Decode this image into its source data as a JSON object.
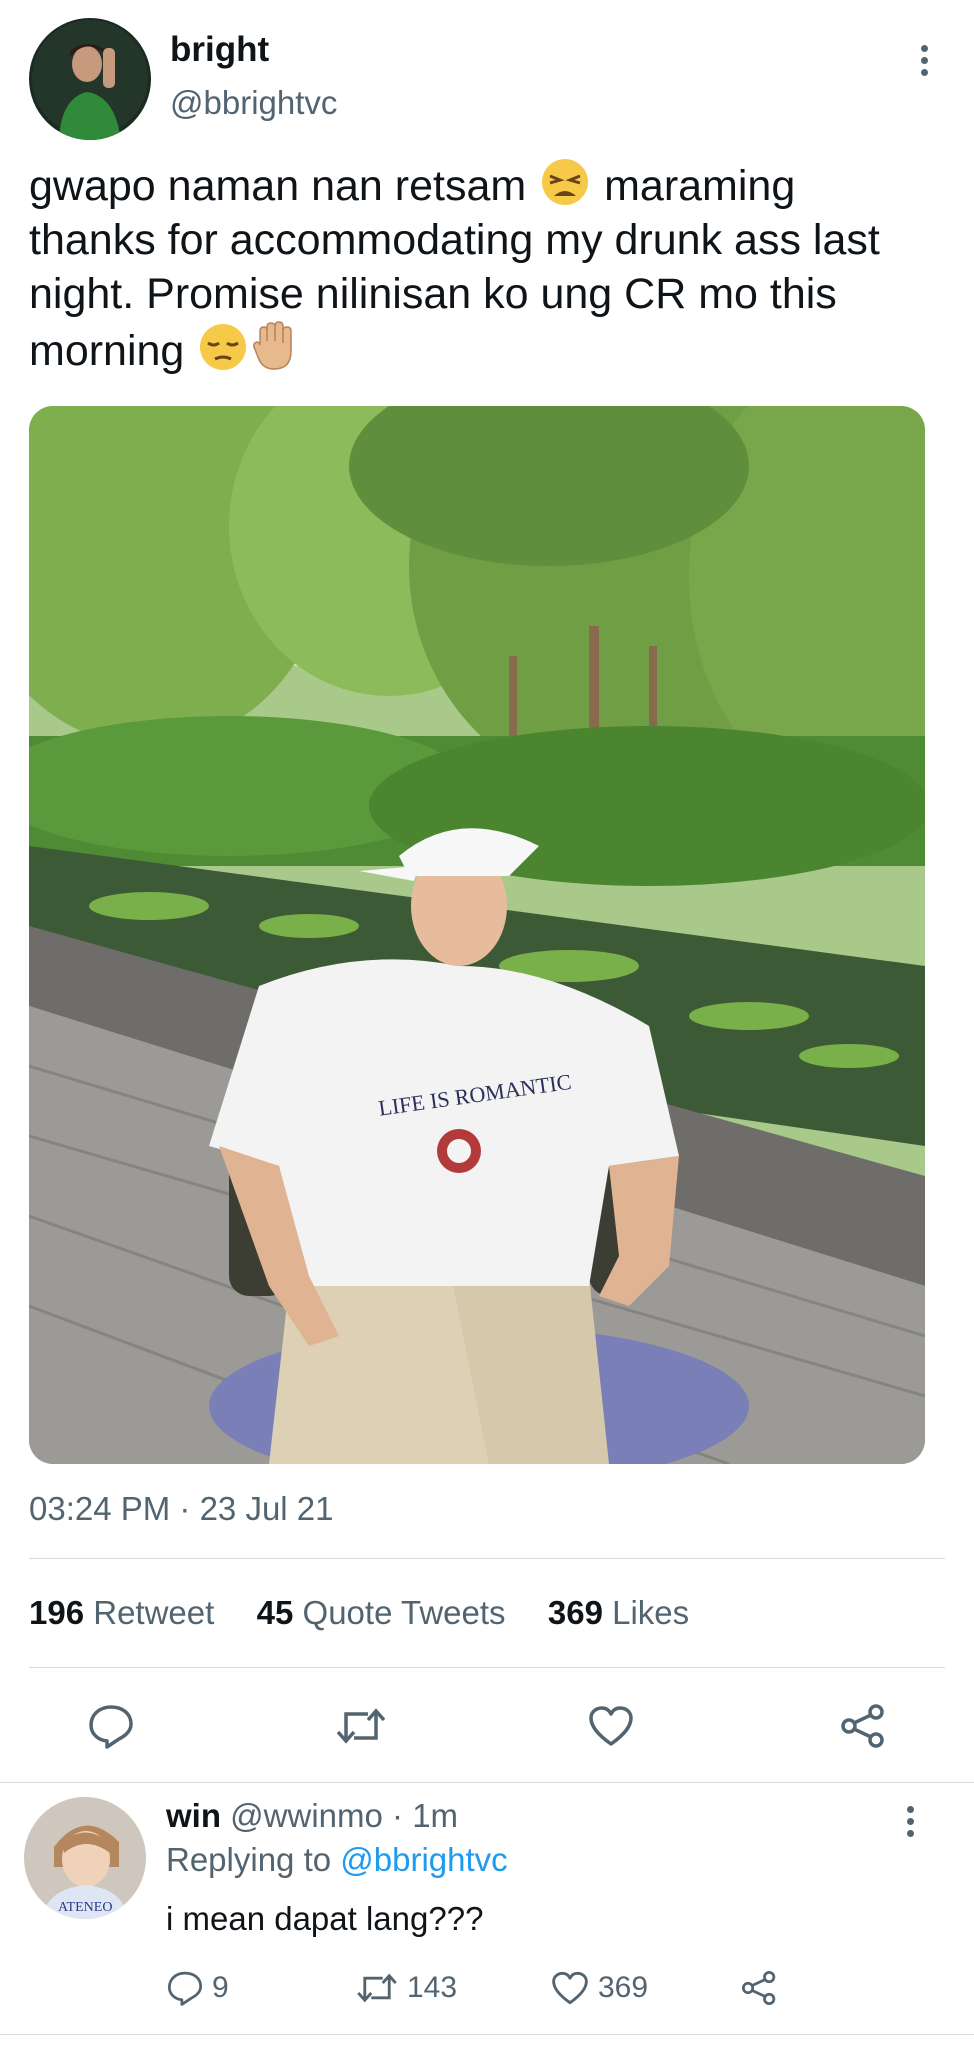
{
  "tweet": {
    "author_name": "bright",
    "author_handle": "@bbrightvc",
    "text_part1": "gwapo naman nan retsam ",
    "text_part2": " maraming thanks for accommodating my drunk ass last night. Promise nilinisan ko ung CR mo this morning ",
    "photo_shirt_text": "LIFE IS ROMANTIC",
    "timestamp": "03:24 PM · 23 Jul 21",
    "stats": {
      "retweet_count": "196",
      "retweet_label": "Retweet",
      "quote_count": "45",
      "quote_label": "Quote Tweets",
      "likes_count": "369",
      "likes_label": "Likes"
    }
  },
  "reply": {
    "author_name": "win",
    "author_handle": "@wwinmo",
    "time": "· 1m",
    "replying_to_label": "Replying to",
    "replying_to_handle": "@bbrightvc",
    "text": "i mean dapat lang???",
    "avatar_jersey_text": "ATENEO",
    "reply_count": "9",
    "retweet_count": "143",
    "like_count": "369"
  },
  "icons": {
    "reply": "reply-icon",
    "retweet": "retweet-icon",
    "like": "heart-icon",
    "share": "share-icon",
    "more": "more-icon"
  },
  "colors": {
    "link": "#1d9bf0",
    "muted": "#536471",
    "text": "#0f1419"
  }
}
